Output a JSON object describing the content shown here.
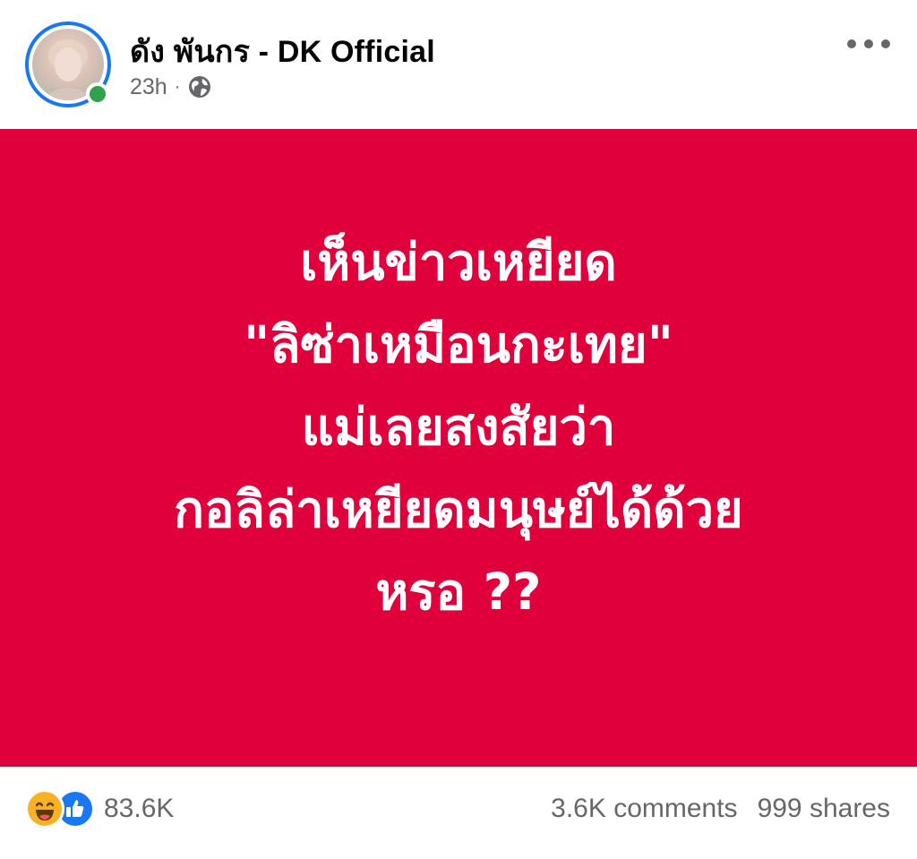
{
  "post": {
    "page_name": "ดัง พันกร - DK Official",
    "time": "23h",
    "separator": "·",
    "audience_icon": "globe-icon",
    "more_icon": "more-horizontal-icon",
    "image_background": "#e0003b",
    "image_text": "เห็นข่าวเหยียด\n\"ลิซ่าเหมือนกะเทย\"\nแม่เลยสงสัยว่า\nกอลิล่าเหยียดมนุษย์ได้ด้วย\nหรอ ??"
  },
  "reactions": {
    "icons": [
      "haha-icon",
      "like-icon"
    ],
    "count": "83.6K"
  },
  "stats": {
    "comments": "3.6K comments",
    "shares": "999 shares"
  },
  "colors": {
    "accent": "#1877f2",
    "online": "#31a24c",
    "secondary_text": "#65676b"
  }
}
